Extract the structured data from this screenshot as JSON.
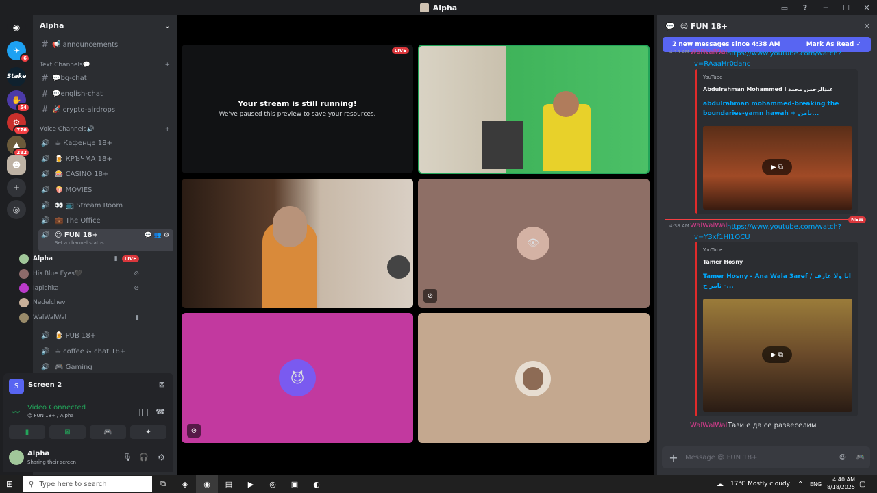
{
  "window": {
    "title": "Alpha"
  },
  "servers": [
    {
      "label": "",
      "badge": ""
    },
    {
      "label": "",
      "badge": "6"
    },
    {
      "label": "Stake",
      "badge": ""
    },
    {
      "label": "",
      "badge": "54"
    },
    {
      "label": "",
      "badge": "776"
    },
    {
      "label": "",
      "badge": "282"
    },
    {
      "label": "",
      "badge": ""
    }
  ],
  "sidebar": {
    "guild_name": "Alpha",
    "channels_top": [
      {
        "name": "📢 announcements"
      }
    ],
    "text_category": "Text Channels💬",
    "text_channels": [
      {
        "name": "💬bg-chat"
      },
      {
        "name": "💬english-chat"
      },
      {
        "name": "🚀 crypto-airdrops"
      }
    ],
    "voice_category": "Voice Channels🔊",
    "voice_channels": [
      {
        "name": "☕ Кафенце 18+"
      },
      {
        "name": "🍺 КРЪЧМА 18+"
      },
      {
        "name": "🎰 CASINO 18+"
      },
      {
        "name": "🍿 MOVIES"
      },
      {
        "name": "👀 📺 Stream Room"
      },
      {
        "name": "💼 The Office"
      }
    ],
    "active_voice": {
      "name": "😌 FUN 18+",
      "status": "Set a channel status"
    },
    "members": [
      {
        "name": "Alpha",
        "live": "LIVE"
      },
      {
        "name": "His Blue Eyes🖤"
      },
      {
        "name": "Iapichka"
      },
      {
        "name": "Nedelchev"
      },
      {
        "name": "WalWalWal"
      }
    ],
    "voice_channels_after": [
      {
        "name": "🍺 PUB 18+"
      },
      {
        "name": "☕ coffee & chat 18+"
      },
      {
        "name": "🎮 Gaming"
      }
    ]
  },
  "voice_panel": {
    "screen_title": "Screen 2",
    "status": "Video Connected",
    "location": "😌 FUN 18+ / Alpha"
  },
  "user": {
    "name": "Alpha",
    "status": "Sharing their screen"
  },
  "stage": {
    "live_badge": "LIVE",
    "paused_title": "Your stream is still running!",
    "paused_sub": "We've paused this preview to save your resources."
  },
  "chat": {
    "channel": "😌 FUN 18+",
    "new_messages": "2 new messages since 4:38 AM",
    "mark_read": "Mark As Read",
    "msg1": {
      "time": "4:15 AM",
      "author": "WalWalWal",
      "link": "https://www.youtube.com/watch?v=RAaaHr0danc"
    },
    "embed1": {
      "provider": "YouTube",
      "author": "Abdulrahman Mohammed I عبدالرحمن محمد",
      "title": "abdulrahman mohammed-breaking the boundaries-yamn hawah + يامن..."
    },
    "new_label": "NEW",
    "msg2": {
      "time": "4:38 AM",
      "author": "WalWalWal",
      "link": "https://www.youtube.com/watch?v=Y3xf1HI1OCU"
    },
    "embed2": {
      "provider": "YouTube",
      "author": "Tamer Hosny",
      "title": "Tamer Hosny - Ana Wala 3aref / انا ولا عارف - تامر ح..."
    },
    "msg3": {
      "author": "WalWalWal",
      "text": "Тази е да се развеселим"
    },
    "composer_placeholder": "Message 😌 FUN 18+"
  },
  "taskbar": {
    "search_placeholder": "Type here to search",
    "weather": "17°C  Mostly cloudy",
    "lang": "ENG",
    "time": "4:40 AM",
    "date": "8/18/2025"
  }
}
